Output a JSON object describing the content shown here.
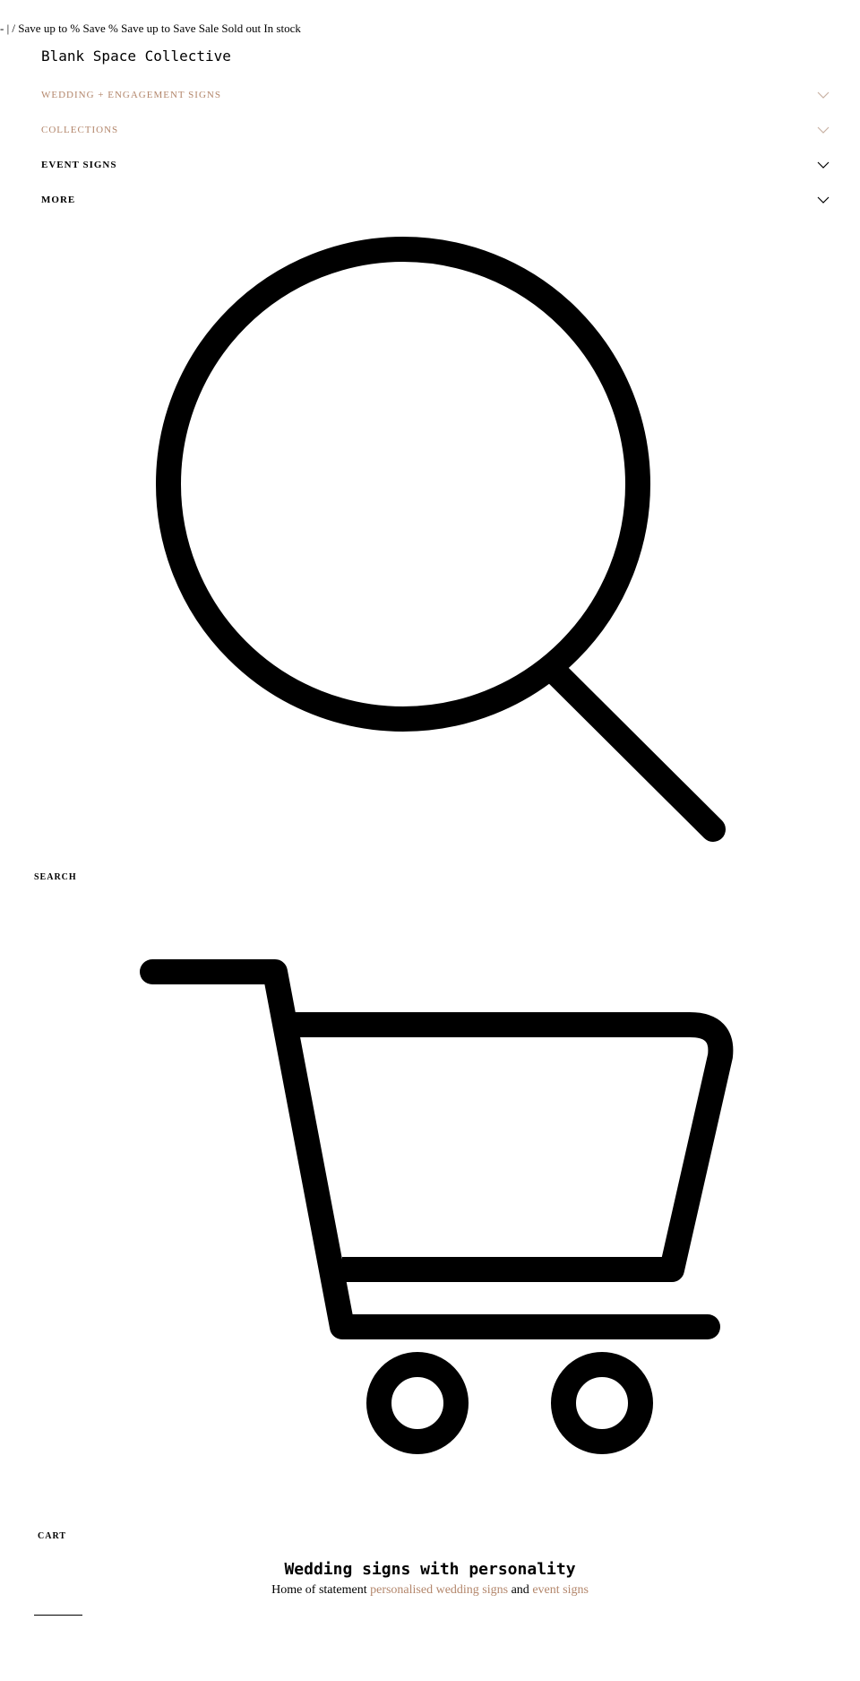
{
  "announcement": "- | / Save up to % Save % Save up to Save Sale Sold out In stock",
  "brand": {
    "name": "Blank Space Collective"
  },
  "nav": {
    "items": [
      {
        "label": "WEDDING + ENGAGEMENT SIGNS"
      },
      {
        "label": "COLLECTIONS"
      },
      {
        "label": "EVENT SIGNS"
      },
      {
        "label": "MORE"
      }
    ]
  },
  "search": {
    "label": "SEARCH"
  },
  "cart": {
    "label": "CART"
  },
  "hero": {
    "title": "Wedding signs with personality",
    "sub_prefix": "Home of statement",
    "sub_link1": "personalised wedding signs",
    "sub_and": "and",
    "sub_link2": "event signs"
  },
  "colors": {
    "accent": "#b3866b",
    "chevron_muted": "#c9b2a4",
    "text": "#000000",
    "background": "#ffffff"
  },
  "icons": {
    "search": "search-icon",
    "cart": "cart-icon",
    "chevron": "chevron-down-icon"
  }
}
